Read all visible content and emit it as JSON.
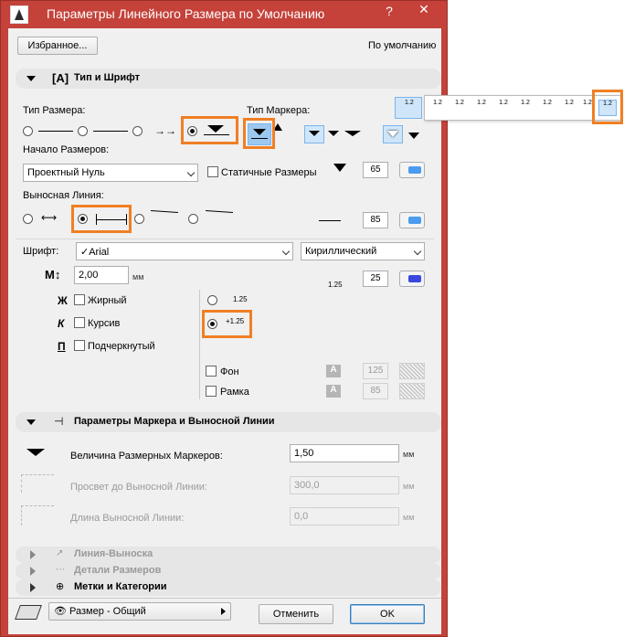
{
  "window": {
    "title": "Параметры Линейного Размера по Умолчанию",
    "help_glyph": "?",
    "close_glyph": "✕"
  },
  "top": {
    "favorites_label": "Избранное...",
    "default_label": "По умолчанию"
  },
  "section_type_font": {
    "title": "Тип и Шрифт",
    "dimension_type_label": "Тип Размера:",
    "marker_type_label": "Тип Маркера:",
    "origin_label": "Начало Размеров:",
    "origin_value": "Проектный Нуль",
    "static_label": "Статичные Размеры",
    "pen_1": "65",
    "witness_label": "Выносная Линия:",
    "pen_2": "85",
    "font_label": "Шрифт:",
    "font_value": "✓Arial",
    "charset_value": "Кириллический",
    "size_value": "2,00",
    "size_unit": "мм",
    "pen_3": "25",
    "bold_glyph": "Ж",
    "bold_label": "Жирный",
    "italic_glyph": "К",
    "italic_label": "Курсив",
    "underline_glyph": "П",
    "underline_label": "Подчеркнутый",
    "sample_1": "1.25",
    "sample_2": "+1.25",
    "pen_sample": "1.25",
    "background_label": "Фон",
    "background_pen": "125",
    "frame_label": "Рамка",
    "frame_pen": "85",
    "a_glyph": "A"
  },
  "section_marker": {
    "title": "Параметры Маркера и Выносной Линии",
    "marker_size_label": "Величина Размерных Маркеров:",
    "marker_size_value": "1,50",
    "gap_label": "Просвет до Выносной Линии:",
    "gap_value": "300,0",
    "length_label": "Длина Выносной Линии:",
    "length_value": "0,0",
    "unit": "мм"
  },
  "section_leader": {
    "title": "Линия-Выноска"
  },
  "section_details": {
    "title": "Детали Размеров"
  },
  "section_tags": {
    "title": "Метки и Категории"
  },
  "bottom": {
    "layer_value": "Размер - Общий",
    "cancel_label": "Отменить",
    "ok_label": "OK"
  },
  "popup": {
    "items": [
      "1.2",
      "1.2",
      "1.2",
      "1.2",
      "1.2",
      "1.2",
      "1.2",
      "1.2",
      "1.2"
    ]
  },
  "colors": {
    "title_bar": "#c4423a",
    "highlight": "#f07f24",
    "selected_button": "#9cc8f0",
    "pen_blue_light": "#4a9cf0",
    "pen_blue_dark": "#3a48e0"
  }
}
